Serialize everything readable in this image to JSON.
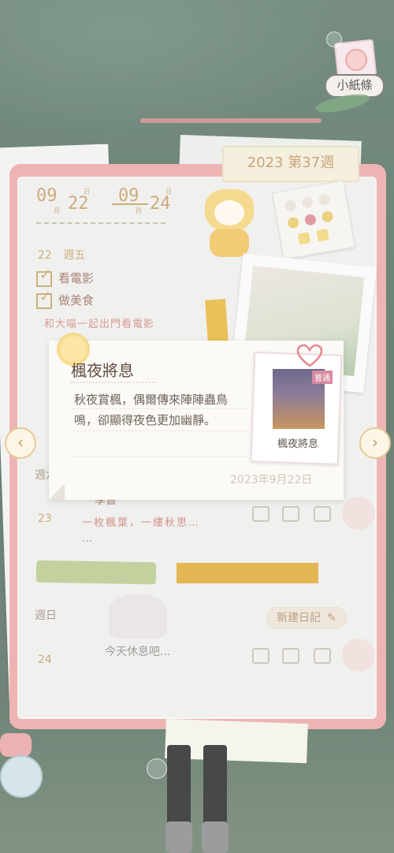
{
  "note_badge": {
    "label": "小紙條"
  },
  "notebook": {
    "week_label": "2023 第37週",
    "date_range": {
      "month1": "09",
      "day1": "22",
      "month2": "09",
      "day2": "24",
      "month_char": "月",
      "day_char": "日"
    },
    "day22": {
      "date": "22",
      "weekday": "週五",
      "tasks": [
        "看電影",
        "做美食"
      ],
      "note": "和大喵一起出門看電影"
    },
    "day23": {
      "weekday_partial": "週六",
      "date": "23",
      "task_partial": "學習",
      "note": "一枚楓葉，一縷秋思…",
      "ellipsis": "…"
    },
    "day24": {
      "weekday": "週日",
      "date": "24",
      "rest_text": "今天休息吧...",
      "new_entry": "新建日記"
    }
  },
  "popup": {
    "title": "楓夜將息",
    "body": "秋夜賞楓，偶爾傳來陣陣蟲鳥鳴，卻顯得夜色更加幽靜。",
    "date": "2023年9月22日",
    "photo_tag": "普通",
    "photo_caption": "楓夜將息"
  },
  "nav": {
    "prev_icon": "chevron-left-icon",
    "next_icon": "chevron-right-icon"
  },
  "colors": {
    "accent": "#c49c64",
    "notebook_border": "#eba6a6",
    "page": "#eeeeec",
    "popup": "#fcfaf6"
  }
}
